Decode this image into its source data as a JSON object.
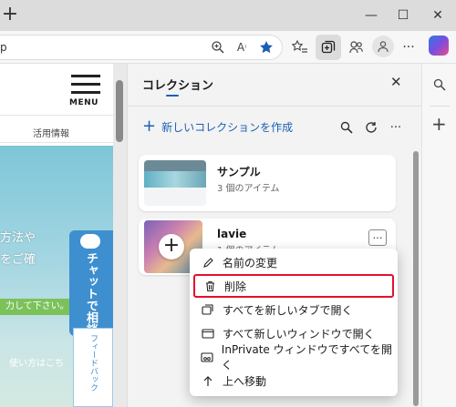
{
  "titlebar": {
    "new_tab": "+",
    "minimize": "—",
    "maximize": "☐",
    "close": "✕"
  },
  "address": {
    "url_fragment": "p"
  },
  "webpage": {
    "menu_label": "MENU",
    "nav_link": "活用情報",
    "hero_text_1": "方法や",
    "hero_text_2": "をご確",
    "green_banner": "力して下さい。",
    "help_text": "使い方はこち",
    "chat_tab": "チャットで相談",
    "feedback_tab": "フィードバック"
  },
  "collections": {
    "title": "コレクション",
    "new_collection": "新しいコレクションを作成",
    "items": [
      {
        "name": "サンプル",
        "count": "3 個のアイテム"
      },
      {
        "name": "lavie",
        "count": "1 個のアイテム"
      }
    ],
    "more_button": "…"
  },
  "context_menu": {
    "items": [
      {
        "label": "名前の変更",
        "icon": "pencil-icon"
      },
      {
        "label": "削除",
        "icon": "trash-icon"
      },
      {
        "label": "すべてを新しいタブで開く",
        "icon": "tabs-icon"
      },
      {
        "label": "すべて新しいウィンドウで開く",
        "icon": "window-icon"
      },
      {
        "label": "InPrivate ウィンドウですべてを開く",
        "icon": "inprivate-icon"
      },
      {
        "label": "上へ移動",
        "icon": "arrow-up-icon"
      }
    ]
  },
  "colors": {
    "accent": "#1a5fb4",
    "highlight_border": "#e5102b",
    "green_banner": "#7bc25a",
    "chat_blue": "#3e8fd0"
  }
}
